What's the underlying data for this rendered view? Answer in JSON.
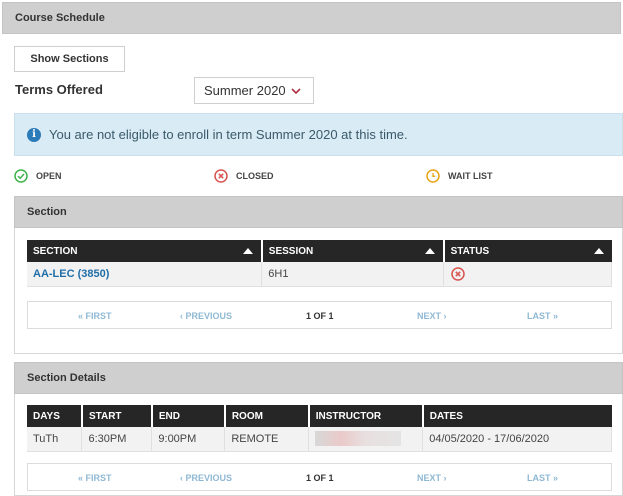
{
  "course_schedule": {
    "title": "Course Schedule",
    "show_sections_label": "Show Sections",
    "terms_label": "Terms Offered",
    "term_selected": "Summer 2020",
    "info_message": "You are not eligible to enroll in term Summer 2020 at this time.",
    "legend": [
      {
        "label": "OPEN",
        "color": "#3cb44b",
        "icon": "check-circle-icon"
      },
      {
        "label": "CLOSED",
        "color": "#d9534f",
        "icon": "x-circle-icon"
      },
      {
        "label": "WAIT LIST",
        "color": "#e8a317",
        "icon": "clock-circle-icon"
      }
    ]
  },
  "section": {
    "title": "Section",
    "columns": [
      "SECTION",
      "SESSION",
      "STATUS"
    ],
    "rows": [
      {
        "section": "AA-LEC (3850)",
        "session": "6H1",
        "status": "closed"
      }
    ],
    "pager": {
      "first": "« FIRST",
      "previous": "‹ PREVIOUS",
      "page": "1 OF 1",
      "next": "NEXT ›",
      "last": "LAST »"
    }
  },
  "section_details": {
    "title": "Section Details",
    "columns": [
      "DAYS",
      "START",
      "END",
      "ROOM",
      "INSTRUCTOR",
      "DATES"
    ],
    "rows": [
      {
        "days": "TuTh",
        "start": "6:30PM",
        "end": "9:00PM",
        "room": "REMOTE",
        "instructor": "",
        "dates": "04/05/2020 - 17/06/2020"
      }
    ],
    "pager": {
      "first": "« FIRST",
      "previous": "‹ PREVIOUS",
      "page": "1 OF 1",
      "next": "NEXT ›",
      "last": "LAST »"
    }
  }
}
